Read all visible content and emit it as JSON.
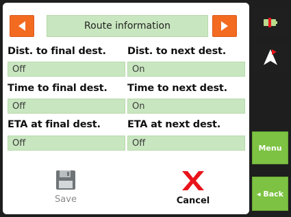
{
  "header": {
    "title": "Route information",
    "prev_icon": "left-arrow-icon",
    "next_icon": "right-arrow-icon"
  },
  "rows": [
    {
      "left_label": "Dist. to final dest.",
      "left_value": "Off",
      "right_label": "Dist. to next dest.",
      "right_value": "On"
    },
    {
      "left_label": "Time to final dest.",
      "left_value": "Off",
      "right_label": "Time to next dest.",
      "right_value": "On"
    },
    {
      "left_label": "ETA at final dest.",
      "left_value": "Off",
      "right_label": "ETA at next dest.",
      "right_value": "Off"
    }
  ],
  "actions": {
    "save_label": "Save",
    "cancel_label": "Cancel"
  },
  "sidebar": {
    "menu_label": "Menu",
    "back_label": "◂ Back"
  },
  "colors": {
    "accent_orange": "#f26b21",
    "field_green": "#c8e6bf",
    "side_green": "#7dc242",
    "cancel_red": "#e8141b"
  }
}
